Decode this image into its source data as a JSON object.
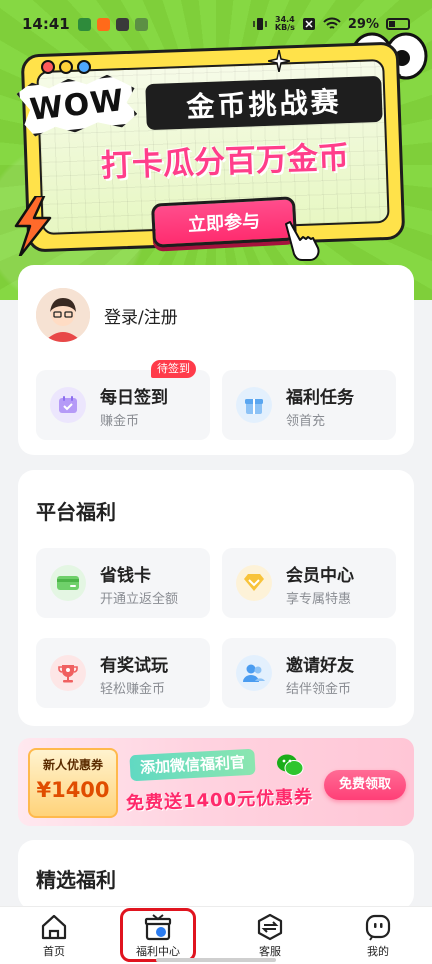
{
  "status_bar": {
    "time": "14:41",
    "speed_value": "34.4",
    "speed_unit": "KB/s",
    "battery": "29%"
  },
  "hero": {
    "wow_text": "WOW",
    "title": "金币挑战赛",
    "subtitle": "打卡瓜分百万金币",
    "cta_label": "立即参与"
  },
  "account": {
    "login_label": "登录/注册"
  },
  "quick_actions": [
    {
      "title": "每日签到",
      "subtitle": "赚金币",
      "badge": "待签到",
      "icon": "calendar-icon",
      "color": "#a88cf5"
    },
    {
      "title": "福利任务",
      "subtitle": "领首充",
      "icon": "gift-icon",
      "color": "#4a9cf0"
    }
  ],
  "platform_benefits": {
    "title": "平台福利",
    "items": [
      {
        "title": "省钱卡",
        "subtitle": "开通立返全额",
        "icon": "card-icon",
        "color": "#4cc45a"
      },
      {
        "title": "会员中心",
        "subtitle": "享专属特惠",
        "icon": "vip-diamond-icon",
        "color": "#f6b51e"
      },
      {
        "title": "有奖试玩",
        "subtitle": "轻松赚金币",
        "icon": "trophy-icon",
        "color": "#f05151"
      },
      {
        "title": "邀请好友",
        "subtitle": "结伴领金币",
        "icon": "friends-icon",
        "color": "#4a9cf0"
      }
    ]
  },
  "promo": {
    "coupon_label": "新人优惠券",
    "coupon_amount": "¥1400",
    "tag": "添加微信福利官",
    "main_text": "免费送1400元优惠券",
    "button": "免费领取"
  },
  "selected_benefits": {
    "title": "精选福利"
  },
  "bottom_nav": [
    {
      "label": "首页",
      "icon": "home-icon"
    },
    {
      "label": "福利中心",
      "icon": "welfare-gift-icon",
      "active": true
    },
    {
      "label": "客服",
      "icon": "customer-service-icon"
    },
    {
      "label": "我的",
      "icon": "profile-icon"
    }
  ]
}
